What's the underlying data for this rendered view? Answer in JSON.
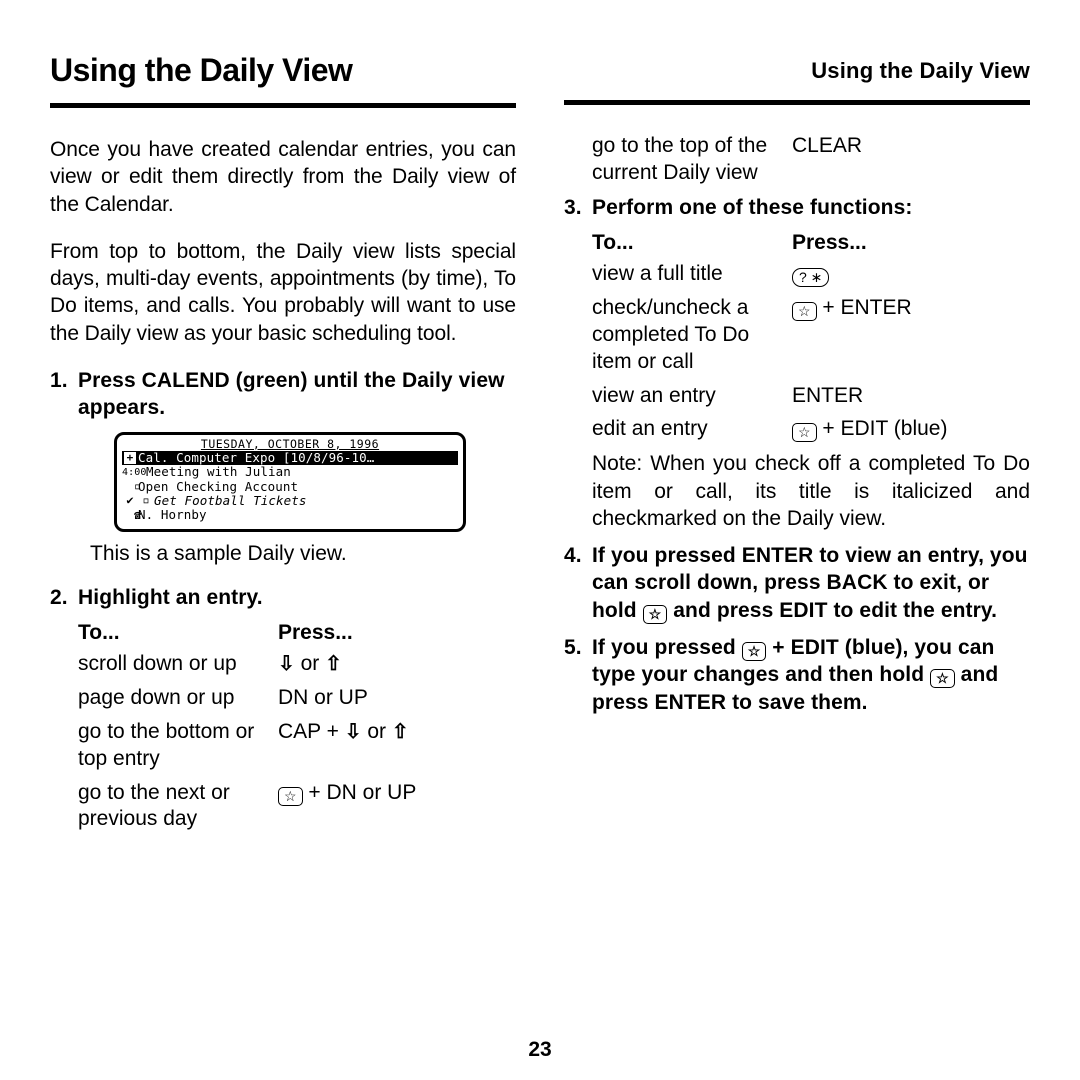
{
  "title_left": "Using the Daily View",
  "title_right": "Using the Daily View",
  "para1": "Once you have created calendar entries, you can view or edit them directly from the Daily view of the Calendar.",
  "para2": "From top to bottom, the Daily view lists special days, multi-day events, appoint­ments (by time), To Do items, and calls. You probably will want to use the Daily view as your basic scheduling tool.",
  "step1_num": "1.",
  "step1": "Press CALEND (green) until the Daily view appears.",
  "lcd": {
    "date": "TUESDAY, OCTOBER 8, 1996",
    "highlight": "Cal. Computer Expo [10/8/96-10…",
    "row2_time": "4:00",
    "row2": "Meeting with Julian",
    "row3": "Open Checking Account",
    "row4": "Get Football Tickets",
    "row5": "N. Hornby"
  },
  "caption": "This is a sample Daily view.",
  "step2_num": "2.",
  "step2": "Highlight an entry.",
  "hdr_to": "To...",
  "hdr_press": "Press...",
  "t2": [
    {
      "to": "scroll down or up",
      "press_kind": "arrows_or"
    },
    {
      "to": "page down or up",
      "press": "DN or UP"
    },
    {
      "to": "go to the bottom or top entry",
      "press_kind": "cap_arrows"
    },
    {
      "to": "go to the next or previous day",
      "press_kind": "star_dnup"
    }
  ],
  "t2cont": {
    "to": "go to the top of the current Daily view",
    "press": "CLEAR"
  },
  "step3_num": "3.",
  "step3": "Perform one of these functions:",
  "t3": [
    {
      "to": "view a full title",
      "press_kind": "qkey"
    },
    {
      "to": "check/uncheck a completed To Do item or call",
      "press_kind": "star_enter"
    },
    {
      "to": "view an entry",
      "press": "ENTER"
    },
    {
      "to": "edit an entry",
      "press_kind": "star_edit"
    }
  ],
  "note3": "Note: When you check off a com­pleted To Do item or call, its title is italicized and checkmarked on the Daily view.",
  "step4_num": "4.",
  "step4_a": "If you pressed ENTER to view an entry, you can scroll down, press BACK to exit, or hold ",
  "step4_b": " and press EDIT to edit the entry.",
  "step5_num": "5.",
  "step5_a": "If you pressed ",
  "step5_b": " + EDIT (blue), you can type your changes and then hold ",
  "step5_c": " and press ENTER to save them.",
  "or": " or ",
  "cap_prefix": "CAP + ",
  "plus_dnup": " + DN or UP",
  "plus_enter": " + ENTER",
  "plus_edit": " + EDIT (blue)",
  "pagenum": "23"
}
